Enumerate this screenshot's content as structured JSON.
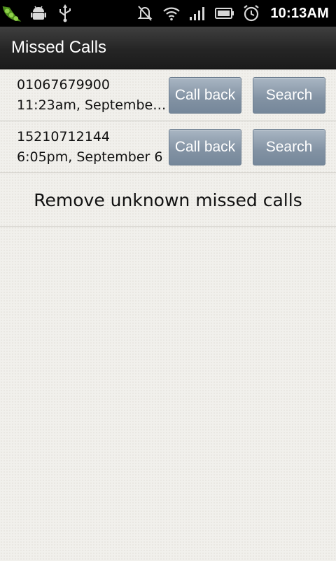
{
  "status_bar": {
    "time": "10:13AM",
    "left_icons": [
      "peas-app-icon",
      "android-debug-icon",
      "usb-icon"
    ],
    "right_icons": [
      "silent-bell-icon",
      "wifi-icon",
      "signal-icon",
      "battery-icon",
      "alarm-icon"
    ]
  },
  "header": {
    "title": "Missed Calls"
  },
  "calls": [
    {
      "number": "01067679900",
      "time": "11:23am, Septembe…",
      "call_back_label": "Call back",
      "search_label": "Search"
    },
    {
      "number": "15210712144",
      "time": "6:05pm, September 6",
      "call_back_label": "Call back",
      "search_label": "Search"
    }
  ],
  "remove_unknown_label": "Remove unknown missed calls",
  "colors": {
    "button": "#8292a3",
    "title_bar": "#2a2a2a",
    "background": "#f1f0ec"
  }
}
